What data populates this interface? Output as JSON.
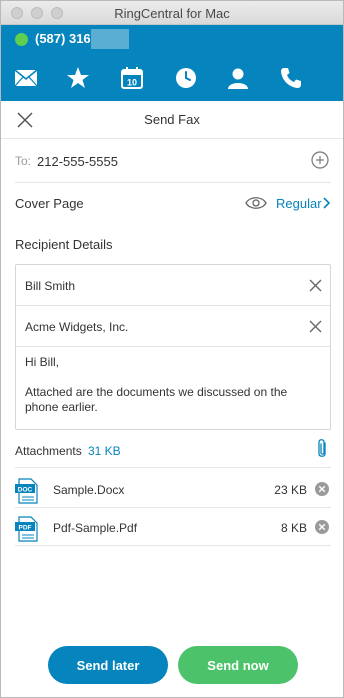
{
  "window": {
    "title": "RingCentral for Mac"
  },
  "status": {
    "phone_number": "(587) 316-",
    "presence_color": "#5fcf4f"
  },
  "nav": {
    "items": [
      {
        "name": "messages",
        "icon": "envelope-icon"
      },
      {
        "name": "favorites",
        "icon": "star-icon"
      },
      {
        "name": "calendar",
        "icon": "calendar-icon",
        "day": "10"
      },
      {
        "name": "recent",
        "icon": "clock-icon"
      },
      {
        "name": "contacts",
        "icon": "person-icon"
      },
      {
        "name": "phone",
        "icon": "phone-icon"
      }
    ]
  },
  "header": {
    "title": "Send Fax"
  },
  "to": {
    "label": "To:",
    "value": "212-555-5555"
  },
  "cover": {
    "label": "Cover Page",
    "value": "Regular"
  },
  "recipient": {
    "label": "Recipient Details",
    "name": "Bill Smith",
    "company": "Acme Widgets, Inc.",
    "message": "Hi Bill,\n\nAttached are the documents we discussed on the phone earlier."
  },
  "attachments": {
    "label": "Attachments",
    "total_size": "31 KB",
    "files": [
      {
        "badge": "DOC",
        "name": "Sample.Docx",
        "size": "23 KB"
      },
      {
        "badge": "PDF",
        "name": "Pdf-Sample.Pdf",
        "size": "8 KB"
      }
    ]
  },
  "buttons": {
    "send_later": "Send later",
    "send_now": "Send now"
  },
  "colors": {
    "brand": "#0684bd",
    "send_now": "#4cc36a"
  }
}
